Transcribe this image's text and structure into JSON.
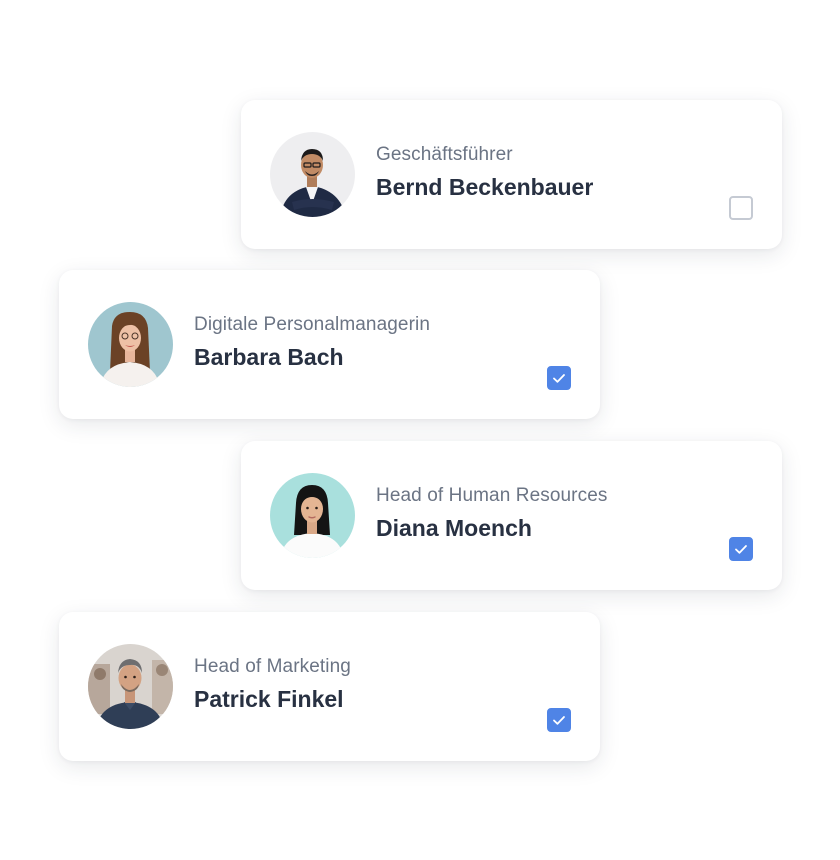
{
  "accent_color": "#4f84e6",
  "people": [
    {
      "role": "Geschäftsführer",
      "name": "Bernd Beckenbauer",
      "checked": false,
      "avatar_icon": "person-photo-icon"
    },
    {
      "role": "Digitale Personalmanagerin",
      "name": "Barbara Bach",
      "checked": true,
      "avatar_icon": "person-photo-icon"
    },
    {
      "role": "Head of Human Resources",
      "name": "Diana Moench",
      "checked": true,
      "avatar_icon": "person-photo-icon"
    },
    {
      "role": "Head of Marketing",
      "name": "Patrick Finkel",
      "checked": true,
      "avatar_icon": "person-photo-icon"
    }
  ]
}
